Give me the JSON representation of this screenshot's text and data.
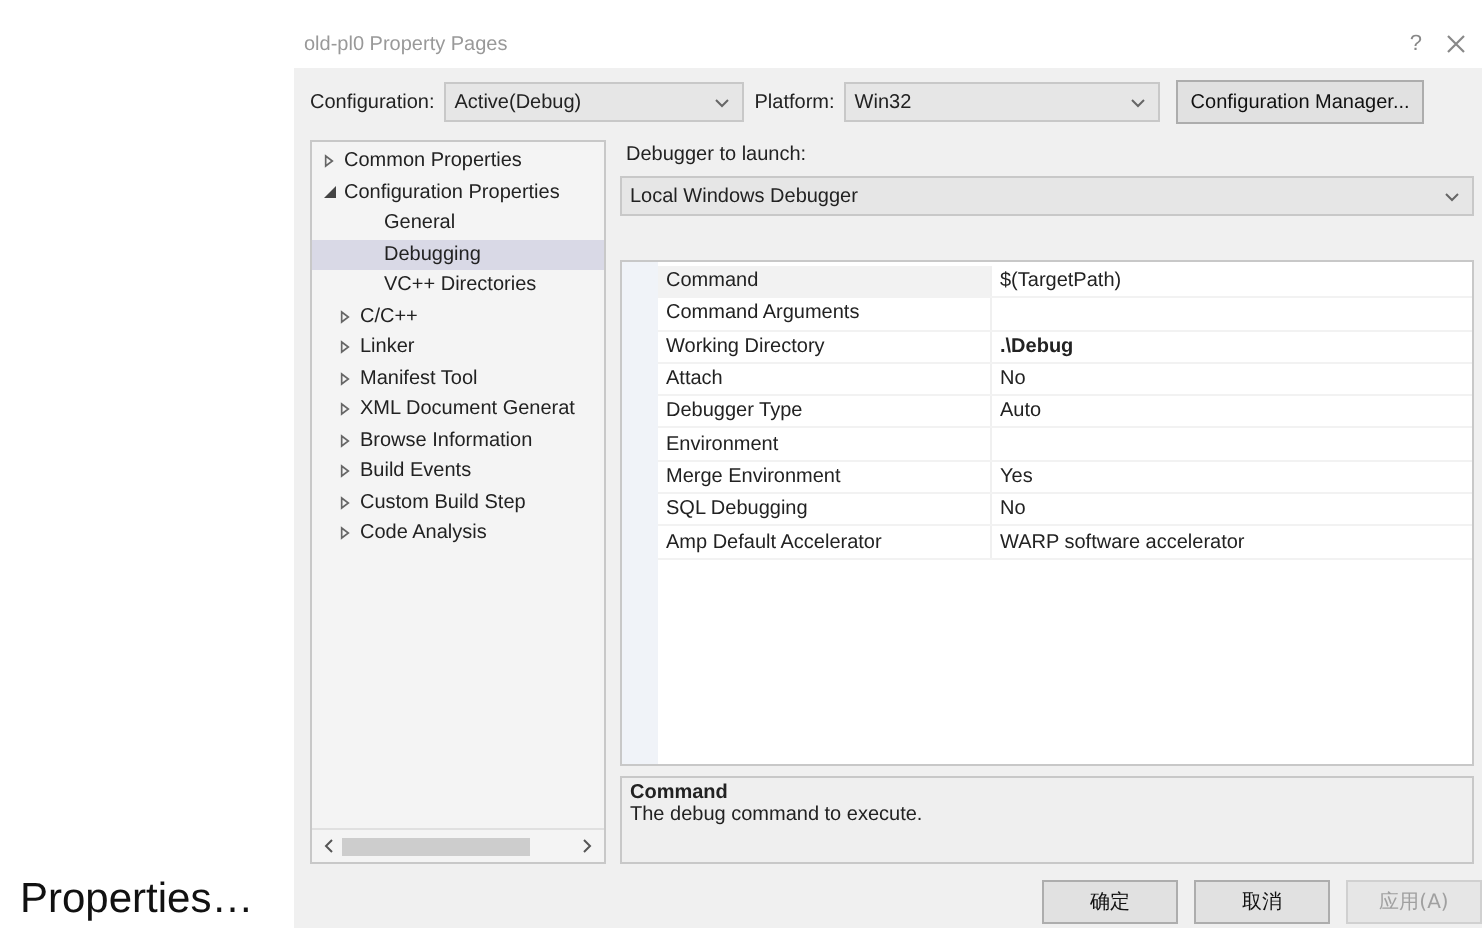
{
  "window": {
    "title": "old-pl0 Property Pages",
    "help": "?"
  },
  "caption": "Properties…",
  "configuration": {
    "label": "Configuration:",
    "value": "Active(Debug)"
  },
  "platform": {
    "label": "Platform:",
    "value": "Win32"
  },
  "configuration_manager_button": "Configuration Manager...",
  "tree": [
    {
      "label": "Common Properties",
      "kind": "group",
      "expanded": false,
      "selected": false
    },
    {
      "label": "Configuration Properties",
      "kind": "group",
      "expanded": true,
      "selected": false,
      "children": [
        {
          "label": "General",
          "kind": "page",
          "selected": false
        },
        {
          "label": "Debugging",
          "kind": "page",
          "selected": true
        },
        {
          "label": "VC++ Directories",
          "kind": "page",
          "selected": false
        },
        {
          "label": "C/C++",
          "kind": "group",
          "expanded": false,
          "selected": false
        },
        {
          "label": "Linker",
          "kind": "group",
          "expanded": false,
          "selected": false
        },
        {
          "label": "Manifest Tool",
          "kind": "group",
          "expanded": false,
          "selected": false
        },
        {
          "label": "XML Document Generat",
          "kind": "group",
          "expanded": false,
          "selected": false
        },
        {
          "label": "Browse Information",
          "kind": "group",
          "expanded": false,
          "selected": false
        },
        {
          "label": "Build Events",
          "kind": "group",
          "expanded": false,
          "selected": false
        },
        {
          "label": "Custom Build Step",
          "kind": "group",
          "expanded": false,
          "selected": false
        },
        {
          "label": "Code Analysis",
          "kind": "group",
          "expanded": false,
          "selected": false
        }
      ]
    }
  ],
  "debugger": {
    "label": "Debugger to launch:",
    "value": "Local Windows Debugger"
  },
  "properties": [
    {
      "name": "Command",
      "value": "$(TargetPath)",
      "modified": false,
      "selected": true
    },
    {
      "name": "Command Arguments",
      "selected": false
    },
    {
      "name": "Working Directory",
      "value": ".\\Debug",
      "modified": true,
      "selected": false
    },
    {
      "name": "Attach",
      "value": "No",
      "modified": false,
      "selected": false
    },
    {
      "name": "Debugger Type",
      "value": "Auto",
      "modified": false,
      "selected": false
    },
    {
      "name": "Environment",
      "selected": false
    },
    {
      "name": "Merge Environment",
      "value": "Yes",
      "modified": false,
      "selected": false
    },
    {
      "name": "SQL Debugging",
      "value": "No",
      "modified": false,
      "selected": false
    },
    {
      "name": "Amp Default Accelerator",
      "value": "WARP software accelerator",
      "modified": false,
      "selected": false
    }
  ],
  "description": {
    "title": "Command",
    "text": "The debug command to execute."
  },
  "buttons": [
    {
      "label": "确定",
      "disabled": false
    },
    {
      "label": "取消",
      "disabled": false
    },
    {
      "label": "应用(A)",
      "disabled": true
    }
  ]
}
